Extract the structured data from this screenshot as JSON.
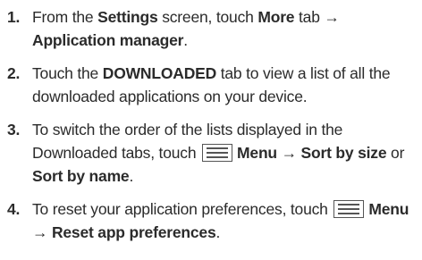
{
  "steps": [
    {
      "number": "1.",
      "t1": "From the ",
      "b1": "Settings",
      "t2": " screen, touch ",
      "b2": "More",
      "t3": " tab ",
      "b3": "→",
      "b4": "Application manager",
      "t4": "."
    },
    {
      "number": "2.",
      "t1": "Touch the ",
      "b1": "DOWNLOADED",
      "t2": " tab to view a list of all the downloaded applications on your device."
    },
    {
      "number": "3.",
      "t1": "To switch the order of the lists displayed in the Downloaded tabs, touch ",
      "icon": "menu-icon",
      "b1": "Menu → Sort by size",
      "t2": " or ",
      "b2": "Sort by name",
      "t3": "."
    },
    {
      "number": "4.",
      "t1": "To reset your application preferences, touch ",
      "icon": "menu-icon",
      "b1": "Menu",
      "b2": "→ Reset app preferences",
      "t2": "."
    }
  ]
}
